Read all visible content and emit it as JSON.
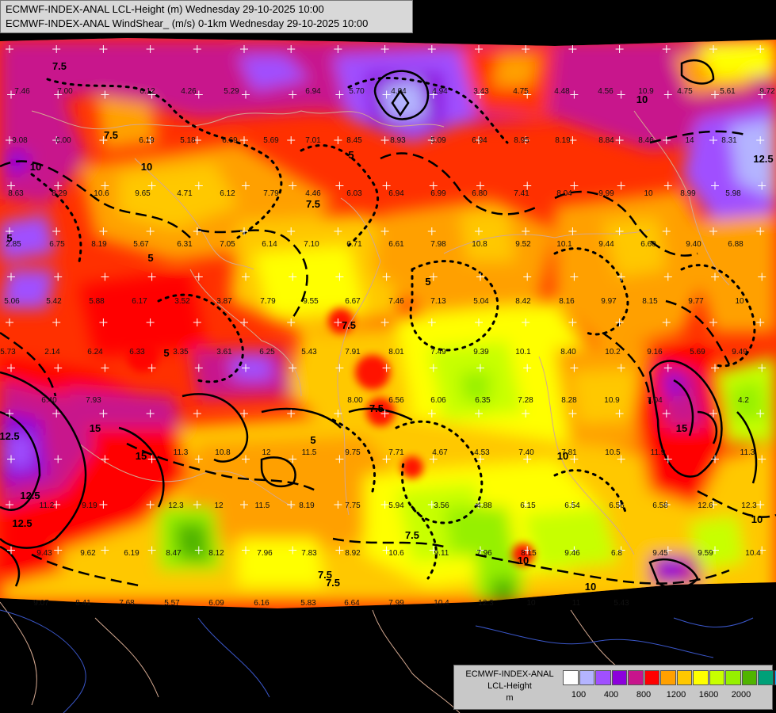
{
  "header": {
    "line1": "ECMWF-INDEX-ANAL LCL-Height (m) Wednesday 29-10-2025 10:00",
    "line2": "ECMWF-INDEX-ANAL WindShear_ (m/s) 0-1km Wednesday 29-10-2025 10:00"
  },
  "legend": {
    "title_line1": "ECMWF-INDEX-ANAL",
    "title_line2": "LCL-Height",
    "title_line3": "m",
    "colors": [
      "#ffffff",
      "#b4b4ff",
      "#a050ff",
      "#8c00dc",
      "#c8148c",
      "#ff0000",
      "#ffa000",
      "#ffc800",
      "#ffff00",
      "#c8ff00",
      "#96f000",
      "#50b400",
      "#00a078",
      "#00aaff"
    ],
    "tick_labels": [
      "100",
      "400",
      "800",
      "1200",
      "1600",
      "2000"
    ]
  },
  "point_values": [
    "7.46",
    "7.00",
    "6.12",
    "4.26",
    "5.29",
    "6.94",
    "5.70",
    "4.04",
    "4.94",
    "3.43",
    "4.75",
    "4.48",
    "4.56",
    "10.9",
    "4.75",
    "5.61",
    "9.72",
    "9.08",
    "6.00",
    "6.19",
    "5.18",
    "6.69",
    "5.69",
    "7.01",
    "8.45",
    "8.93",
    "5.09",
    "6.94",
    "8.95",
    "8.19",
    "8.84",
    "8.46",
    "14",
    "8.31",
    "8.63",
    "8.29",
    "10.6",
    "9.65",
    "4.71",
    "6.12",
    "7.79",
    "4.46",
    "6.03",
    "6.94",
    "6.99",
    "6.80",
    "7.41",
    "8.04",
    "9.99",
    "10",
    "8.99",
    "5.98",
    "2.85",
    "6.75",
    "8.19",
    "5.67",
    "6.31",
    "7.05",
    "6.14",
    "7.10",
    "6.71",
    "6.61",
    "7.98",
    "10.8",
    "9.52",
    "10.1",
    "9.44",
    "6.60",
    "9.40",
    "6.88",
    "5.06",
    "5.42",
    "5.88",
    "6.17",
    "3.52",
    "3.87",
    "7.79",
    "9.55",
    "6.67",
    "7.46",
    "7.13",
    "5.04",
    "8.42",
    "8.16",
    "9.97",
    "8.15",
    "9.77",
    "10",
    "5.73",
    "2.14",
    "6.24",
    "6.33",
    "3.35",
    "3.61",
    "6.25",
    "5.43",
    "7.91",
    "8.01",
    "7.49",
    "9.39",
    "10.1",
    "8.40",
    "10.2",
    "9.16",
    "5.69",
    "9.49",
    "6.40",
    "7.93",
    "8.00",
    "6.56",
    "6.06",
    "6.35",
    "7.28",
    "8.28",
    "10.9",
    "7.04",
    "4.2",
    "11.3",
    "10.8",
    "12",
    "11.5",
    "9.75",
    "7.71",
    "4.67",
    "4.53",
    "7.40",
    "7.81",
    "10.5",
    "11.9",
    "11.3",
    "11.2",
    "9.19",
    "12.3",
    "12",
    "11.5",
    "8.19",
    "7.75",
    "5.94",
    "3.56",
    "4.88",
    "6.15",
    "6.54",
    "6.56",
    "6.58",
    "12.6",
    "12.3",
    "9.43",
    "9.62",
    "6.19",
    "8.47",
    "8.12",
    "7.96",
    "7.83",
    "8.92",
    "10.6",
    "9.11",
    "7.96",
    "8.15",
    "9.46",
    "6.8",
    "9.45",
    "9.59",
    "10.4",
    "9.07",
    "8.41",
    "7.68",
    "5.57",
    "6.09",
    "6.16",
    "5.83",
    "6.64",
    "7.99",
    "10.4",
    "12.3",
    "10",
    "11",
    "5.43"
  ],
  "contour_labels": [
    "7.5",
    "5",
    "7.5",
    "10",
    "10",
    "12.5",
    "5",
    "7.5",
    "5",
    "7.5",
    "5",
    "5",
    "7.5",
    "5",
    "10",
    "7.5",
    "10",
    "12.5",
    "12.5",
    "15",
    "15",
    "12.5",
    "7.5",
    "10",
    "10",
    "7.5",
    "15",
    "10"
  ]
}
